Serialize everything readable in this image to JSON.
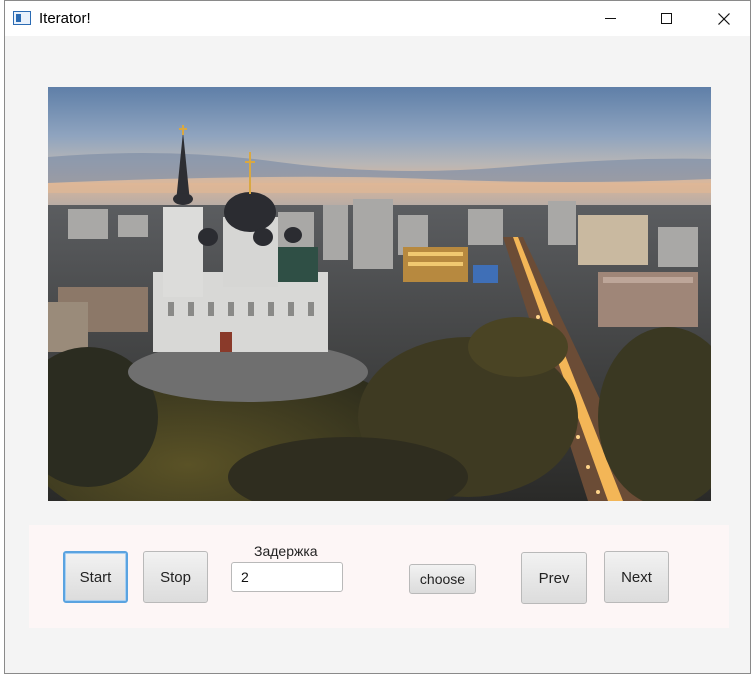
{
  "window": {
    "title": "Iterator!",
    "icon": "app-window-icon"
  },
  "controls": {
    "start_label": "Start",
    "stop_label": "Stop",
    "delay_label": "Задержка",
    "delay_value": "2",
    "choose_label": "choose",
    "prev_label": "Prev",
    "next_label": "Next"
  },
  "image": {
    "subject": "Aerial photo of city with cathedral at dusk"
  },
  "colors": {
    "focus_border": "#5aa3e0",
    "panel_background": "#fdf6f6"
  }
}
